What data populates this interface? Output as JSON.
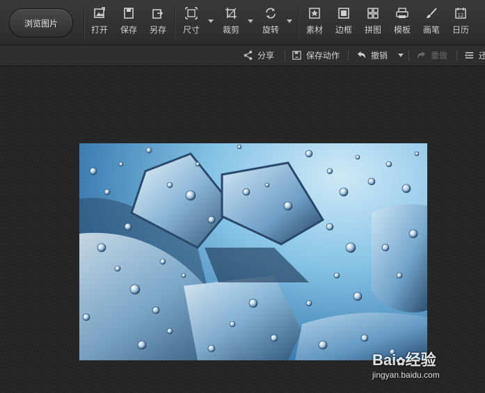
{
  "toolbar": {
    "browse_label": "浏览图片",
    "tools": [
      {
        "id": "open",
        "label": "打开",
        "icon": "open-image-icon"
      },
      {
        "id": "save",
        "label": "保存",
        "icon": "save-icon"
      },
      {
        "id": "saveas",
        "label": "另存",
        "icon": "save-as-icon"
      },
      {
        "id": "size",
        "label": "尺寸",
        "icon": "resize-icon"
      },
      {
        "id": "crop",
        "label": "裁剪",
        "icon": "crop-icon"
      },
      {
        "id": "rotate",
        "label": "旋转",
        "icon": "rotate-icon"
      },
      {
        "id": "material",
        "label": "素材",
        "icon": "star-material-icon"
      },
      {
        "id": "border",
        "label": "边框",
        "icon": "frame-icon"
      },
      {
        "id": "collage",
        "label": "拼图",
        "icon": "grid-collage-icon"
      },
      {
        "id": "template",
        "label": "模板",
        "icon": "template-icon"
      },
      {
        "id": "brush",
        "label": "画笔",
        "icon": "brush-icon"
      },
      {
        "id": "calendar",
        "label": "日历",
        "icon": "calendar-icon",
        "icon_text": "12"
      }
    ]
  },
  "subbar": {
    "share": "分享",
    "save_action": "保存动作",
    "undo": "撤销",
    "redo": "重做",
    "more": "还"
  },
  "watermark": {
    "logo": "Bai",
    "logo_suffix": "经验",
    "site": "jingyan.baidu.com"
  },
  "colors": {
    "toolbar_bg": "#333333",
    "canvas_bg": "#242424",
    "accent_water": "#86c3e6"
  }
}
